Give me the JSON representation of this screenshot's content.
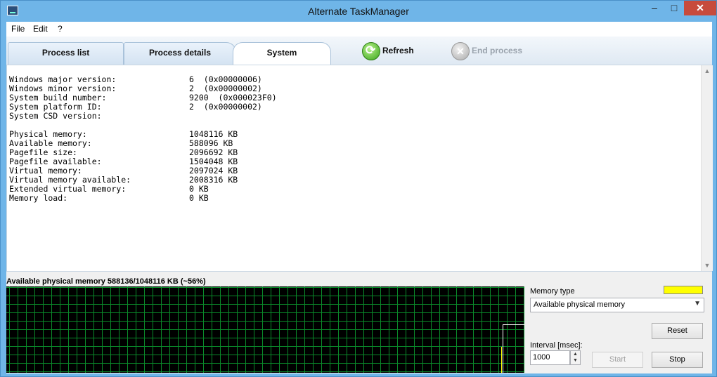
{
  "window": {
    "title": "Alternate TaskManager",
    "minimize": "–",
    "maximize": "□",
    "close": "✕"
  },
  "menu": [
    "File",
    "Edit",
    "?"
  ],
  "tabs": [
    "Process list",
    "Process details",
    "System"
  ],
  "toolbar": {
    "refresh": "Refresh",
    "end_process": "End process"
  },
  "system_info": {
    "os": [
      {
        "label": "Windows major version:",
        "value": "6  (0x00000006)"
      },
      {
        "label": "Windows minor version:",
        "value": "2  (0x00000002)"
      },
      {
        "label": "System build number:",
        "value": "9200  (0x000023F0)"
      },
      {
        "label": "System platform ID:",
        "value": "2  (0x00000002)"
      },
      {
        "label": "System CSD version:",
        "value": ""
      }
    ],
    "memory": [
      {
        "label": "Physical memory:",
        "value": "1048116 KB"
      },
      {
        "label": "Available memory:",
        "value": "588096 KB"
      },
      {
        "label": "Pagefile size:",
        "value": "2096692 KB"
      },
      {
        "label": "Pagefile available:",
        "value": "1504048 KB"
      },
      {
        "label": "Virtual memory:",
        "value": "2097024 KB"
      },
      {
        "label": "Virtual memory available:",
        "value": "2008316 KB"
      },
      {
        "label": "Extended virtual memory:",
        "value": "0 KB"
      },
      {
        "label": "Memory load:",
        "value": "0 KB"
      }
    ]
  },
  "graph": {
    "label": "Available physical memory 588136/1048116 KB (~56%)",
    "available_fraction": 0.56
  },
  "controls": {
    "memory_type_label": "Memory type",
    "memory_type_color": "#ffff00",
    "memory_type_value": "Available physical memory",
    "reset": "Reset",
    "interval_label": "Interval [msec]:",
    "interval_value": "1000",
    "start": "Start",
    "stop": "Stop"
  }
}
